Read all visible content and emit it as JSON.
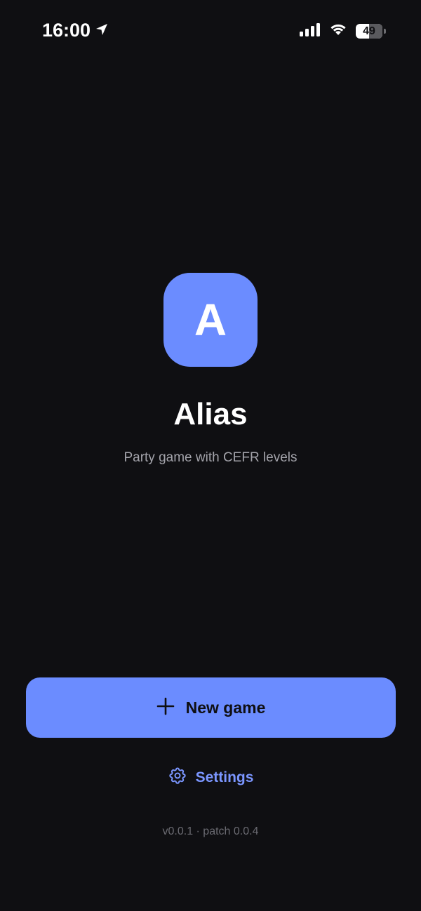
{
  "status_bar": {
    "time": "16:00",
    "battery_level": "49",
    "icons": [
      "location-arrow-icon",
      "cellular-signal-icon",
      "wifi-icon",
      "battery-icon"
    ]
  },
  "app": {
    "icon_letter": "A",
    "title": "Alias",
    "subtitle": "Party game with CEFR levels"
  },
  "actions": {
    "new_game_label": "New game",
    "new_game_icon": "plus-icon",
    "settings_label": "Settings",
    "settings_icon": "gear-icon"
  },
  "footer": {
    "version": "v0.0.1 · patch 0.0.4"
  },
  "colors": {
    "background": "#0f0f12",
    "accent": "#6b8cff",
    "link": "#7b96ff",
    "subtitle": "#a3a3aa",
    "muted": "#6b6b72"
  }
}
